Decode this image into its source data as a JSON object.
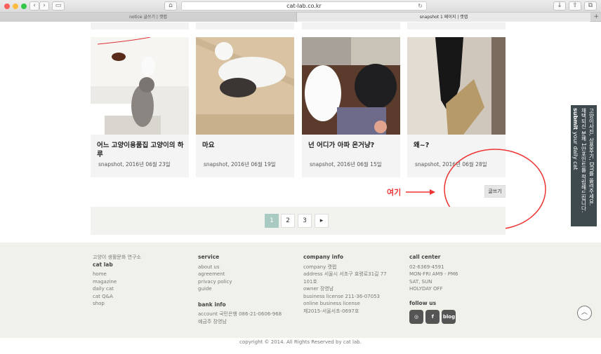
{
  "browser": {
    "url": "cat-lab.co.kr",
    "tabs": [
      {
        "label": "notice 글쓰기 | 캣랩"
      },
      {
        "label": "snapshot 1 페이지 | 캣랩"
      }
    ],
    "new_tab": "+"
  },
  "posts": [
    {
      "title": "어느 고양이용품집 고양이의 하루",
      "date": "snapshot, 2016년 06월 23일"
    },
    {
      "title": "마요",
      "date": "snapshot, 2016년 06월 19일"
    },
    {
      "title": "넌 어디가 아파 온거냥?",
      "date": "snapshot, 2016년 06월 15일"
    },
    {
      "title": "왜~?",
      "date": "snapshot, 2016년 06월 28일"
    }
  ],
  "annotation": {
    "text": "여기"
  },
  "write_button": "글쓰기",
  "pagination": {
    "pages": [
      "1",
      "2",
      "3"
    ],
    "active": "1",
    "next": "▸"
  },
  "footer": {
    "brand_sub": "고양이 생활문화 연구소",
    "brand": "cat lab",
    "brand_links": [
      "home",
      "magazine",
      "daily cat",
      "cat Q&A",
      "shop"
    ],
    "service_title": "service",
    "service_links": [
      "about us",
      "agreement",
      "privacy policy",
      "guide"
    ],
    "bank_title": "bank info",
    "bank_lines": [
      "account 국민은행 086-21-0606-968",
      "예금주 장영남"
    ],
    "company_title": "company info",
    "company_lines": [
      "company 캣랩",
      "address 서울시 서초구 효령로31길 77",
      "101호",
      "owner 장영남",
      "business license 211-36-07053",
      "online business license",
      "제2015-서울서초-0697호"
    ],
    "call_title": "call center",
    "call_lines": [
      "02-6369-4591",
      "MON-FRI AM9 - PM6",
      "SAT, SUN",
      "HOLYDAY OFF"
    ],
    "follow_title": "follow us",
    "social": [
      "instagram-icon",
      "facebook-icon",
      "blog-icon"
    ],
    "blog_label": "blog",
    "copyright": "copyright © 2014. All Rights Reserved by cat lab.",
    "top_button": "︿"
  },
  "side_banner": {
    "submit": "submit",
    "submit_sub": "your daily cat",
    "lines": [
      "고양이사진, 상품후기, DIY를 올려주세요.",
      "채택되신 분께 1만포인트를 적립해드립니다."
    ]
  },
  "colors": {
    "accent_active_page": "#a9c9c3",
    "annotation": "#e33333",
    "banner": "#3f4a4e"
  }
}
